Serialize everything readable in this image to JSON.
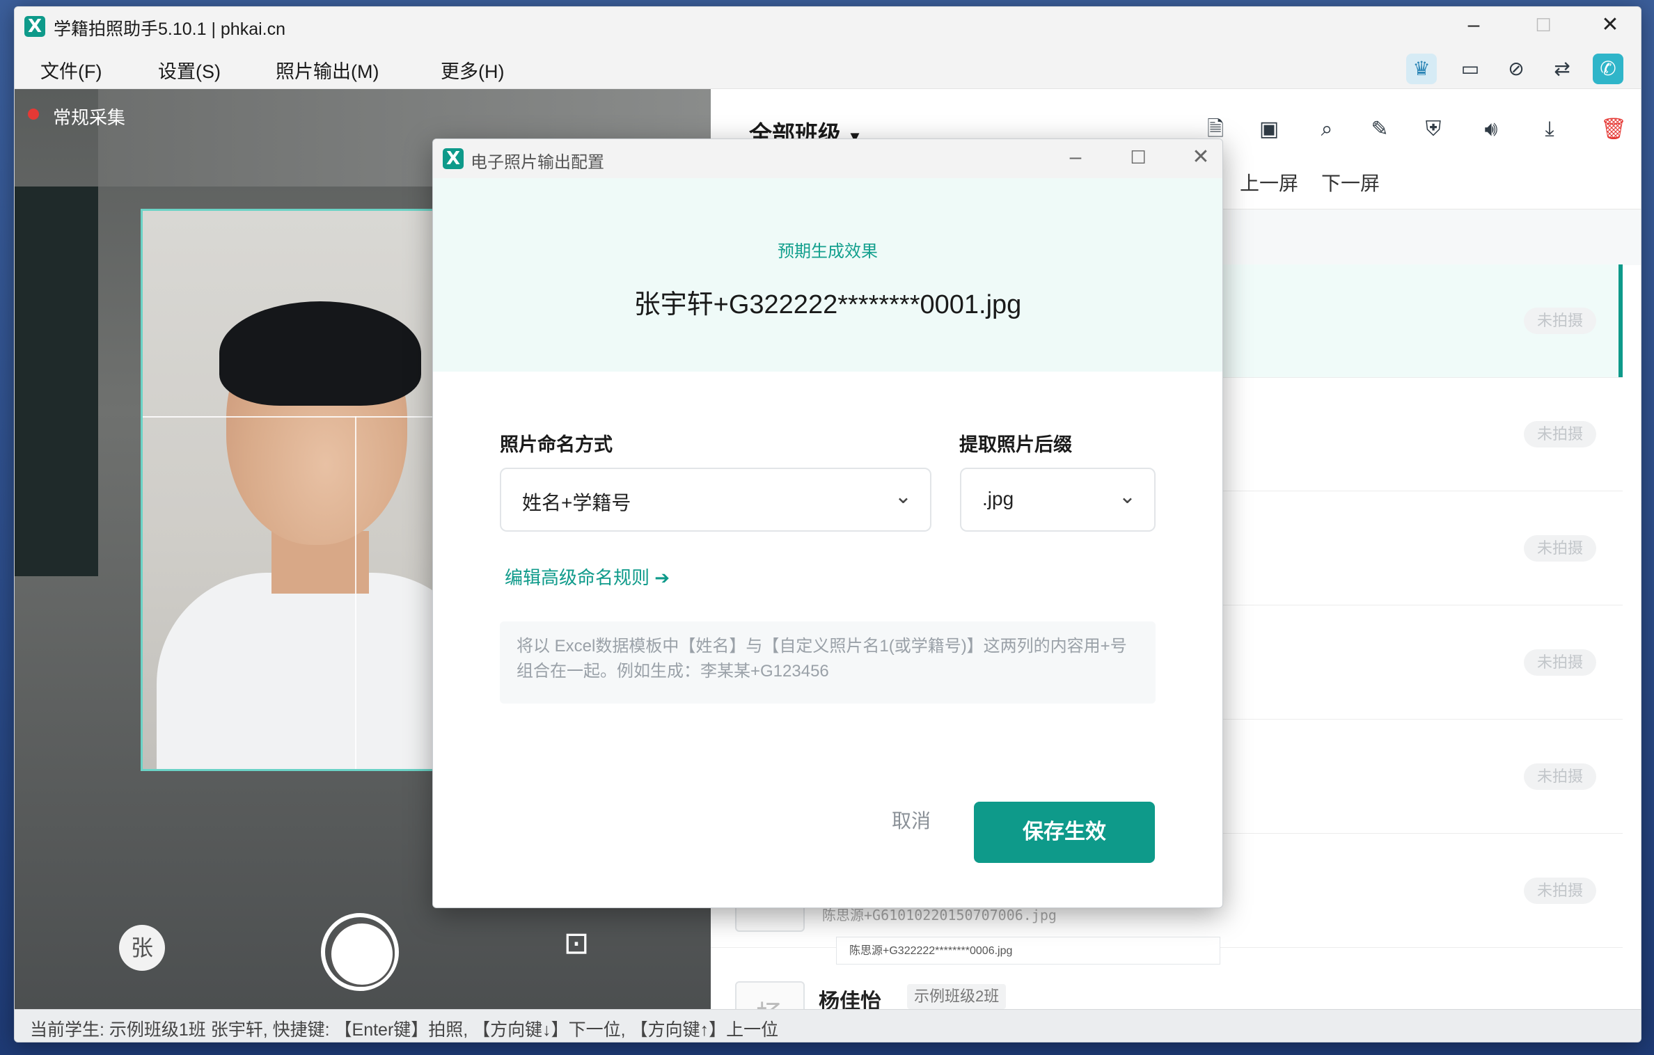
{
  "app": {
    "title": "学籍拍照助手5.10.1 | phkai.cn"
  },
  "menu": [
    "文件(F)",
    "设置(S)",
    "照片输出(M)",
    "更多(H)"
  ],
  "camera": {
    "mode_label": "常规采集",
    "avatar_char": "张"
  },
  "right": {
    "class_title": "全部班级",
    "prev_label": "上一屏",
    "next_label": "下一屏",
    "badge": "未拍摄",
    "partial_file": "陈思源+G61010220150707006.jpg",
    "tip_file": "陈思源+G322222********0006.jpg",
    "student_name": "杨佳怡",
    "student_class": "示例班级2班",
    "student_thumb_char": "杨"
  },
  "status": "当前学生: 示例班级1班 张宇轩, 快捷键: 【Enter键】拍照, 【方向键↓】下一位, 【方向键↑】上一位",
  "dialog": {
    "title": "电子照片输出配置",
    "preview_label": "预期生成效果",
    "preview_filename": "张宇轩+G322222********0001.jpg",
    "naming_label": "照片命名方式",
    "naming_value": "姓名+学籍号",
    "suffix_label": "提取照片后缀",
    "suffix_value": ".jpg",
    "advanced_link": "编辑高级命名规则 ➔",
    "hint": "将以 Excel数据模板中【姓名】与【自定义照片名1(或学籍号)】这两列的内容用+号组合在一起。例如生成：李某某+G123456",
    "cancel_label": "取消",
    "save_label": "保存生效"
  },
  "colors": {
    "accent": "#0e9a8a",
    "delete": "#e53935"
  }
}
